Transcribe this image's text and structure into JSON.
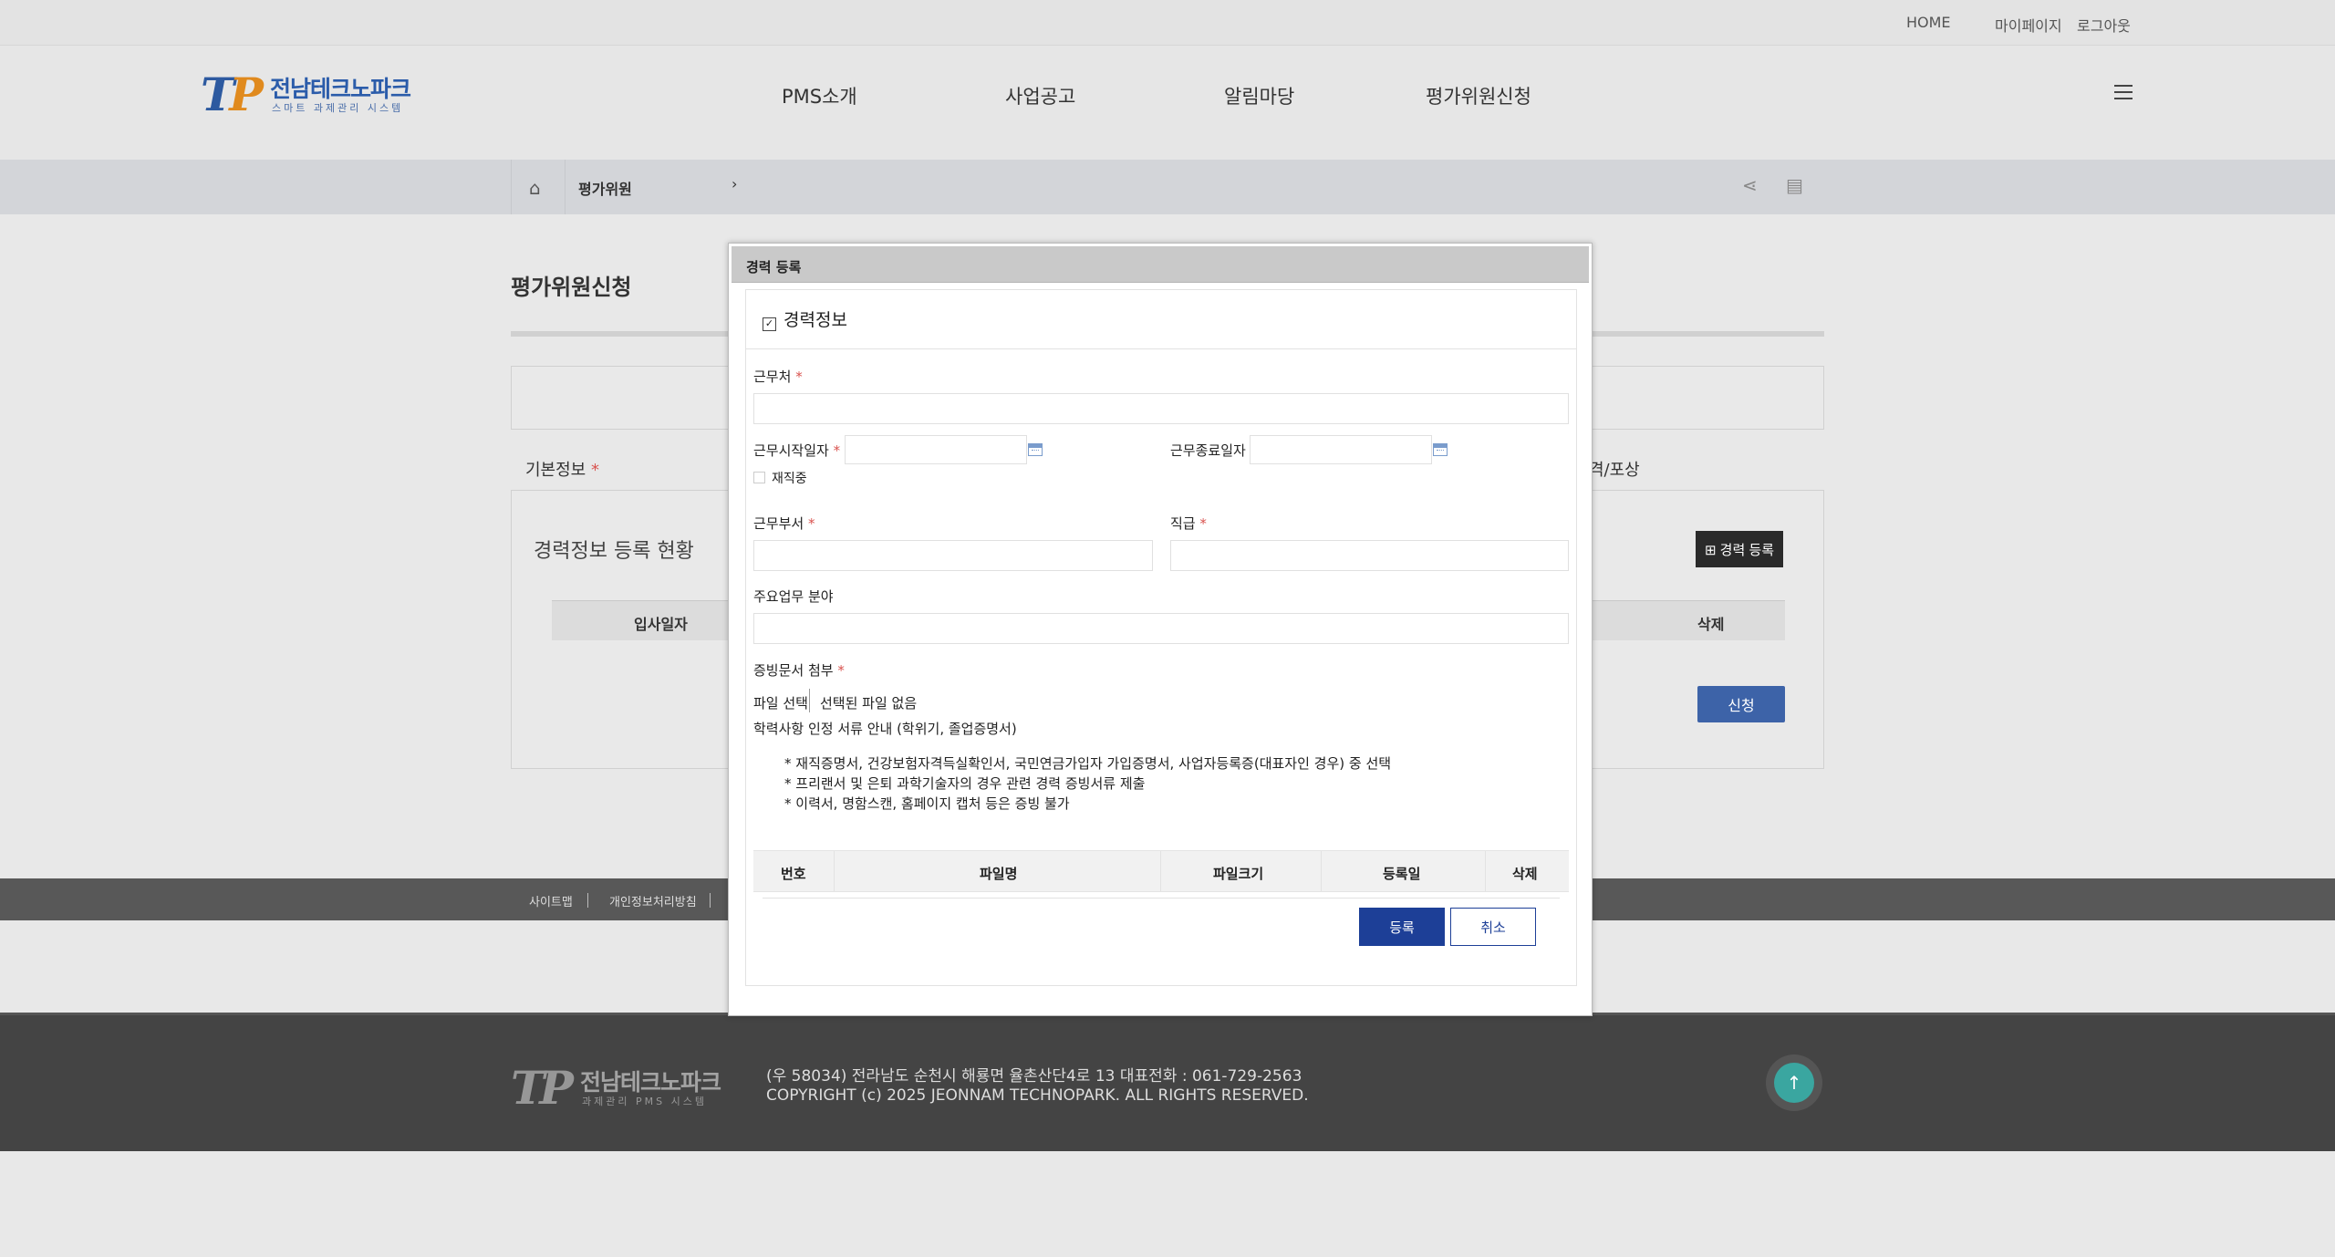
{
  "top_links": {
    "home": "HOME",
    "mypage": "마이페이지",
    "logout": "로그아웃"
  },
  "logo": {
    "mark": "TP",
    "title": "전남테크노파크",
    "subtitle": "스마트 과제관리 시스템"
  },
  "gnb": [
    "PMS소개",
    "사업공고",
    "알림마당",
    "평가위원신청"
  ],
  "location": {
    "current": "평가위원",
    "arrow": "›"
  },
  "page": {
    "title": "평가위원신청",
    "tab_basic": "기본정보",
    "tab_right": "격/포상",
    "status_title": "경력정보 등록 현황",
    "career_register_button": "⊞ 경력 등록",
    "table_headers": {
      "start_date": "입사일자",
      "delete": "삭제"
    },
    "apply_button": "신청"
  },
  "bottom_links": {
    "sitemap": "사이트맵",
    "privacy": "개인정보처리방침"
  },
  "footer": {
    "logo_title": "전남테크노파크",
    "logo_subtitle": "과제관리 PMS 시스템",
    "address": "(우 58034) 전라남도 순천시 해룡면 율촌산단4로 13   대표전화 : 061-729-2563",
    "copyright": "COPYRIGHT (c) 2025 JEONNAM TECHNOPARK. ALL RIGHTS RESERVED."
  },
  "modal": {
    "title": "경력 등록",
    "section_title": "경력정보",
    "fields": {
      "workplace": "근무처",
      "start_date": "근무시작일자",
      "end_date": "근무종료일자",
      "currently_employed": "재직중",
      "department": "근무부서",
      "position": "직급",
      "main_field": "주요업무 분야",
      "attachment": "증빙문서 첨부"
    },
    "required_mark": "*",
    "file_button": "파일 선택",
    "file_none": "선택된 파일 없음",
    "notes": {
      "heading": "학력사항 인정 서류 안내 (학위기, 졸업증명서)",
      "line1": "* 재직증명서, 건강보험자격득실확인서, 국민연금가입자 가입증명서, 사업자등록증(대표자인 경우) 중 선택",
      "line2": "* 프리랜서 및 은퇴 과학기술자의 경우 관련 경력 증빙서류 제출",
      "line3": "* 이력서, 명함스캔, 홈페이지 캡처 등은 증빙 불가"
    },
    "file_table_headers": {
      "no": "번호",
      "name": "파일명",
      "size": "파일크기",
      "date": "등록일",
      "delete": "삭제"
    },
    "register_button": "등록",
    "cancel_button": "취소"
  },
  "colors": {
    "primary_button": "#1d3f97",
    "apply_button": "#3d63a8",
    "required": "#d9534f",
    "to_top": "#3aa6a0"
  },
  "icons": {
    "home": "home-icon",
    "share": "share-icon",
    "print": "print-icon",
    "menu": "hamburger-icon",
    "calendar": "calendar-icon",
    "top": "arrow-up-icon"
  }
}
